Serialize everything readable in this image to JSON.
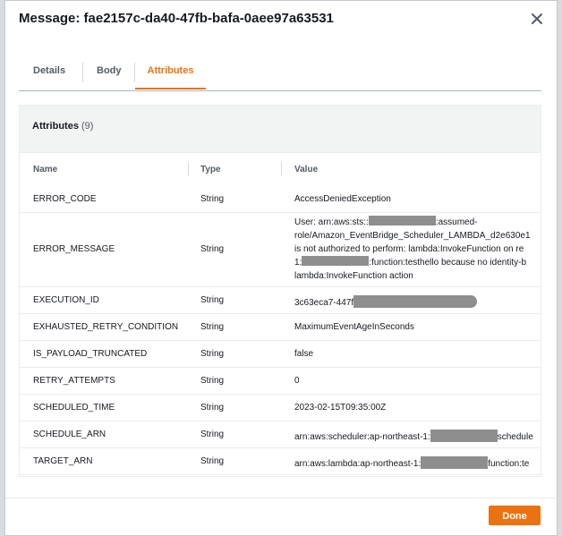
{
  "modal": {
    "title": "Message: fae2157c-da40-47fb-bafa-0aee97a63531",
    "close_icon": "close-icon"
  },
  "tabs": [
    {
      "label": "Details",
      "active": false
    },
    {
      "label": "Body",
      "active": false
    },
    {
      "label": "Attributes",
      "active": true
    }
  ],
  "panel": {
    "title": "Attributes",
    "count": "(9)"
  },
  "table": {
    "columns": [
      "Name",
      "Type",
      "Value"
    ],
    "rows": [
      {
        "name": "ERROR_CODE",
        "type": "String",
        "value": "AccessDeniedException"
      },
      {
        "name": "ERROR_MESSAGE",
        "type": "String",
        "value_lines": [
          [
            "User: arn:aws:sts::",
            "REDACTED",
            ":assumed-"
          ],
          [
            "role/Amazon_EventBridge_Scheduler_LAMBDA_d2e630e1"
          ],
          [
            "is not authorized to perform: lambda:InvokeFunction on re"
          ],
          [
            "1:",
            "REDACTED",
            ":function:testhello because no identity-b"
          ],
          [
            "lambda:InvokeFunction action"
          ]
        ]
      },
      {
        "name": "EXECUTION_ID",
        "type": "String",
        "value": "3c63eca7-447f"
      },
      {
        "name": "EXHAUSTED_RETRY_CONDITION",
        "type": "String",
        "value": "MaximumEventAgeInSeconds"
      },
      {
        "name": "IS_PAYLOAD_TRUNCATED",
        "type": "String",
        "value": "false"
      },
      {
        "name": "RETRY_ATTEMPTS",
        "type": "String",
        "value": "0"
      },
      {
        "name": "SCHEDULED_TIME",
        "type": "String",
        "value": "2023-02-15T09:35:00Z"
      },
      {
        "name": "SCHEDULE_ARN",
        "type": "String",
        "value_prefix": "arn:aws:scheduler:ap-northeast-1:",
        "value_suffix": "schedule"
      },
      {
        "name": "TARGET_ARN",
        "type": "String",
        "value_prefix": "arn:aws:lambda:ap-northeast-1:",
        "value_suffix": "function:te"
      }
    ]
  },
  "footer": {
    "done_label": "Done"
  },
  "colors": {
    "accent": "#ec7211",
    "redaction": "#8e8e8e"
  }
}
